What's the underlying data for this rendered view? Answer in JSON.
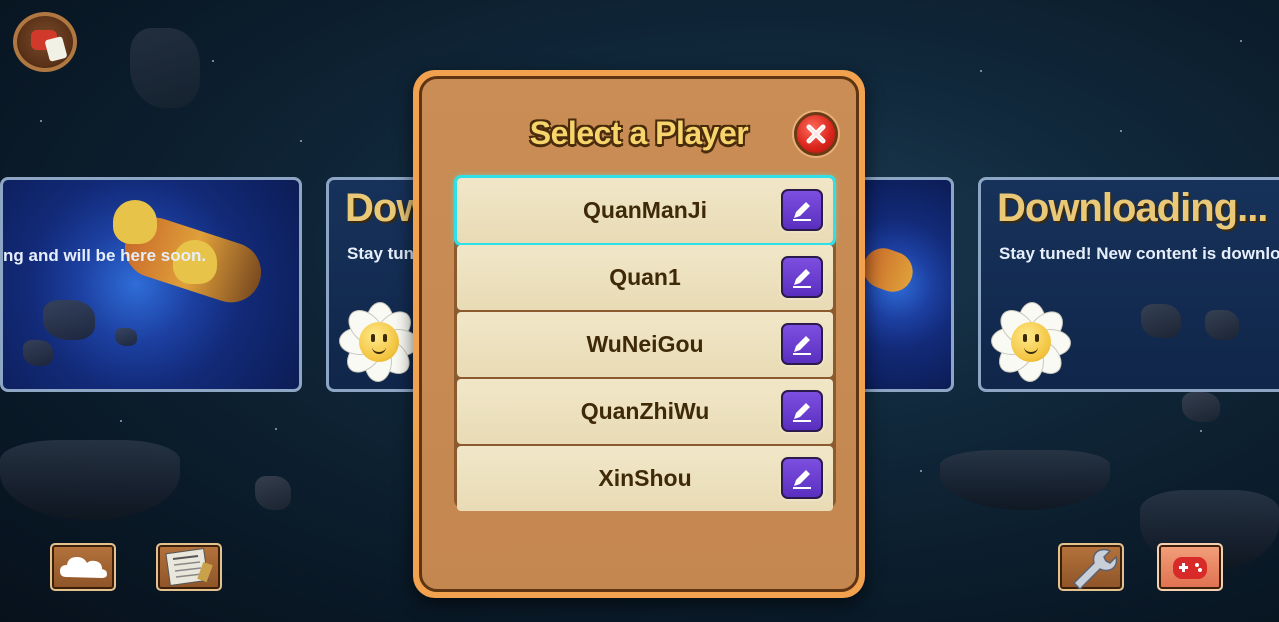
{
  "colors": {
    "modal_border": "#f2a24e",
    "modal_fill": "#c58750",
    "title_text": "#f7d46c",
    "row_fill": "#f1e7c8",
    "selected_outline": "#2fe0e8",
    "edit_button": "#6a3cd0",
    "close_button": "#d8231a"
  },
  "background": {
    "card_left": {
      "subtitle": "ng and will be here soon."
    },
    "card_mid": {
      "title": "Dow",
      "subtitle": "Stay tun"
    },
    "card_right": {
      "title": "Downloading...",
      "subtitle": "Stay tuned! New content is downlo"
    }
  },
  "toolbar": {
    "icons": [
      "avatar-icon",
      "cloud-icon",
      "newspaper-icon",
      "wrench-icon",
      "gamepad-icon"
    ]
  },
  "dialog": {
    "title": "Select a Player",
    "close_icon": "close-icon",
    "players": [
      {
        "name": "QuanManJi",
        "selected": true
      },
      {
        "name": "Quan1",
        "selected": false
      },
      {
        "name": "WuNeiGou",
        "selected": false
      },
      {
        "name": "QuanZhiWu",
        "selected": false
      },
      {
        "name": "XinShou",
        "selected": false
      }
    ],
    "edit_icon": "pencil-icon"
  }
}
